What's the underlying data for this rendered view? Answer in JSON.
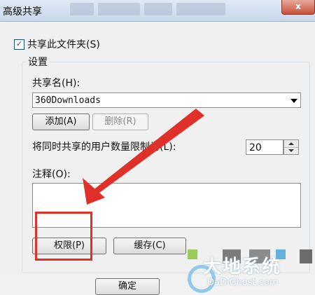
{
  "window": {
    "title": "高级共享",
    "close_label": "x"
  },
  "share_checkbox": {
    "label": "共享此文件夹(S)",
    "checked": true,
    "check_glyph": "✓"
  },
  "settings": {
    "legend": "设置",
    "share_name_label": "共享名(H):",
    "share_name_value": "360Downloads",
    "add_button": "添加(A)",
    "remove_button": "删除(R)",
    "user_limit_label": "将同时共享的用户数量限制为(L):",
    "user_limit_value": "20",
    "comment_label": "注释(O):",
    "comment_value": ""
  },
  "buttons": {
    "permissions": "权限(P)",
    "caching": "缓存(C)",
    "ok": "确定"
  },
  "watermark": {
    "title": "大地系统",
    "url": "DaDiGhost.com"
  },
  "colors": {
    "highlight": "#e0302a",
    "arrow": "#e0302a",
    "dialog_bg": "#f0f0f0"
  },
  "icons": {
    "close": "close-icon",
    "dropdown": "chevron-down-icon",
    "spin_up": "spin-up-icon",
    "spin_down": "spin-down-icon",
    "annotation_arrow": "red-arrow-icon"
  }
}
